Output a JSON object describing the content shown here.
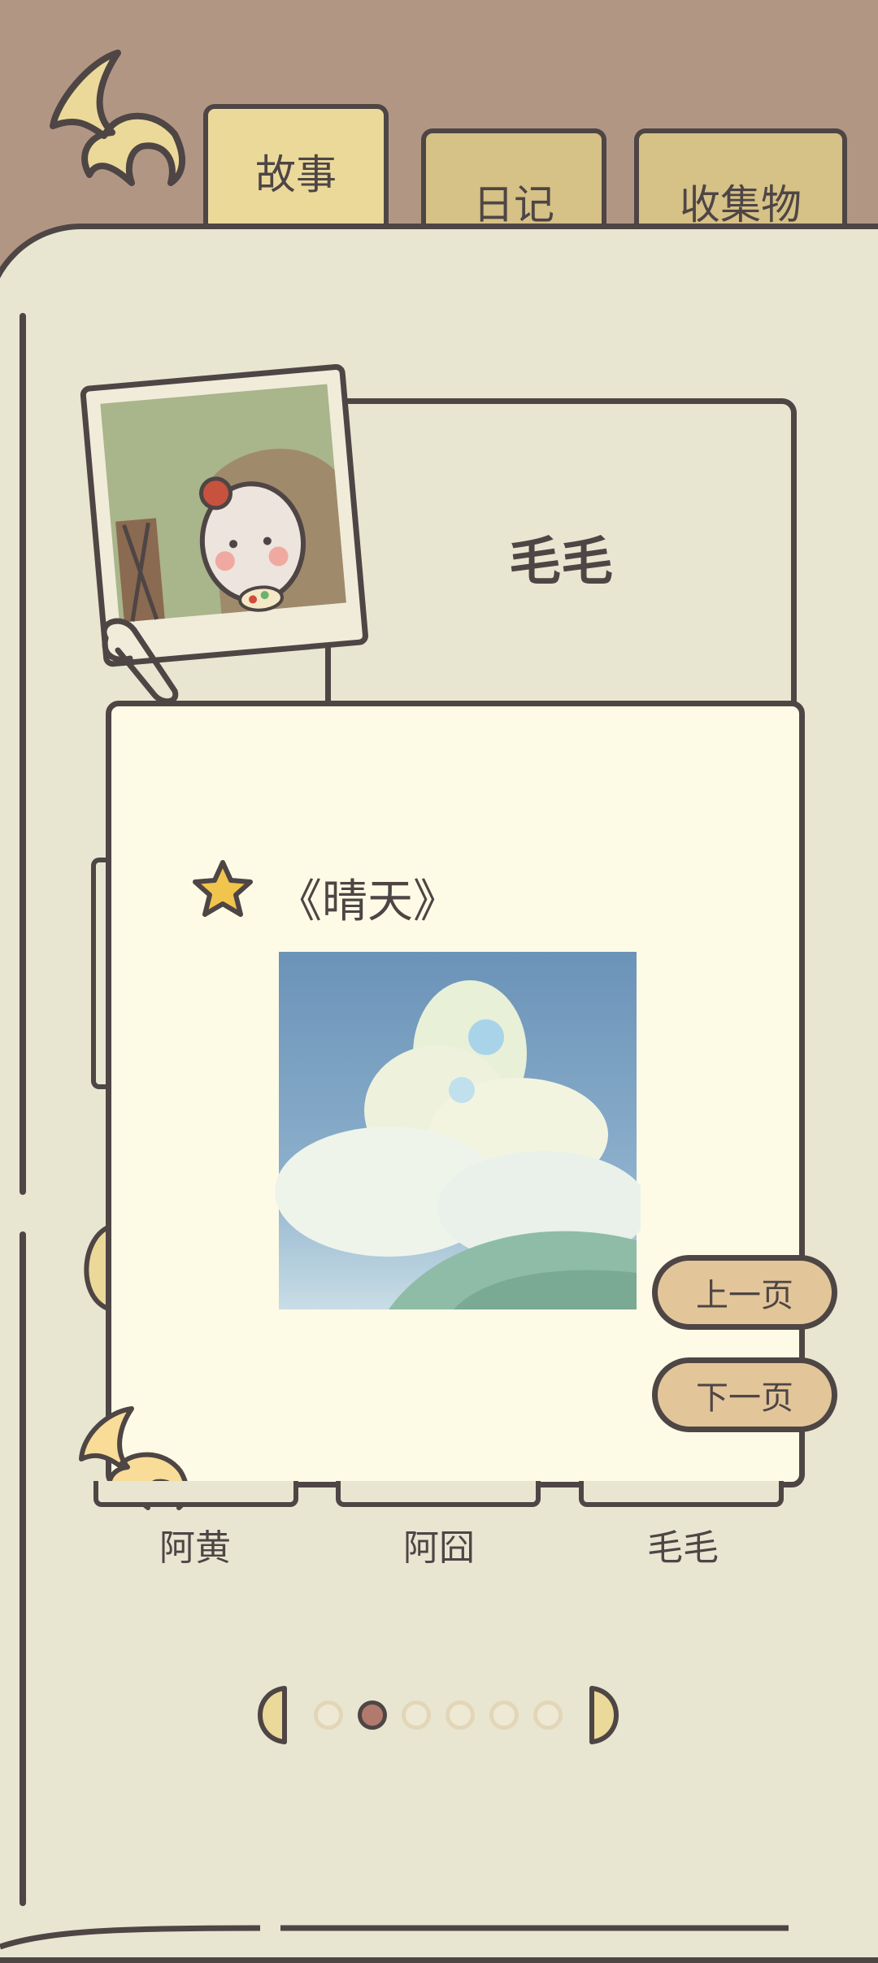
{
  "nav": {
    "tabs": [
      {
        "label": "故事",
        "active": true
      },
      {
        "label": "日记",
        "active": false
      },
      {
        "label": "收集物",
        "active": false
      }
    ]
  },
  "character": {
    "name": "毛毛"
  },
  "story": {
    "title": "《晴天》",
    "prev_label": "上一页",
    "next_label": "下一页"
  },
  "characters": [
    "阿黄",
    "阿囧",
    "毛毛"
  ],
  "pagination": {
    "total": 6,
    "current": 2
  },
  "colors": {
    "background_top": "#b29684",
    "book": "#e8e6d1",
    "card": "#fdfbe6",
    "outline": "#4e4545",
    "tab": "#d6c186",
    "button": "#e2c69a",
    "active_dot": "#b27a6d"
  }
}
